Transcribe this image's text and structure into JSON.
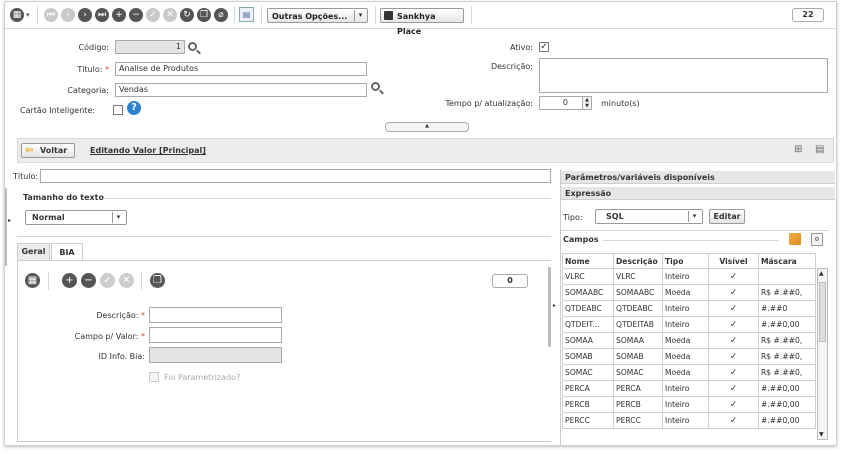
{
  "toolbar": {
    "outras_opcoes": "Outras Opções...",
    "sankhya_place": "Sankhya Place",
    "counter": "22"
  },
  "form": {
    "codigo_label": "Código:",
    "codigo_value": "1",
    "titulo_label": "Título:",
    "titulo_value": "Analise de Produtos",
    "categoria_label": "Categoria:",
    "categoria_value": "Vendas",
    "cartao_label": "Cartão Inteligente:",
    "ativo_label": "Ativo:",
    "descricao_label": "Descrição:",
    "tempo_label": "Tempo p/ atualização:",
    "tempo_value": "0",
    "minutos": "minuto(s)"
  },
  "nav": {
    "voltar": "Voltar",
    "editando": "Editando Valor [Principal]"
  },
  "left": {
    "titulo_label": "Título:",
    "tamanho_label": "Tamanho do texto",
    "tamanho_value": "Normal",
    "tabs": [
      "Geral",
      "BIA"
    ],
    "bia_counter": "0",
    "descricao_label": "Descrição:",
    "campo_label": "Campo p/ Valor:",
    "id_label": "ID Info. Bia:",
    "foi_param": "Foi Parametrizado?"
  },
  "right": {
    "param_header": "Parâmetros/variáveis disponíveis",
    "expr_header": "Expressão",
    "tipo_label": "Tipo:",
    "tipo_value": "SQL",
    "editar": "Editar",
    "campos_label": "Campos",
    "columns": [
      "Nome",
      "Descrição",
      "Tipo",
      "Visível",
      "Máscara"
    ],
    "rows": [
      [
        "VLRC",
        "VLRC",
        "Inteiro",
        "✓",
        ""
      ],
      [
        "SOMAABC",
        "SOMAABC",
        "Moeda",
        "✓",
        "R$ #.##0,"
      ],
      [
        "QTDEABC",
        "QTDEABC",
        "Inteiro",
        "✓",
        "#.##0"
      ],
      [
        "QTDEIT...",
        "QTDEITAB",
        "Inteiro",
        "✓",
        "#.##0,00"
      ],
      [
        "SOMAA",
        "SOMAA",
        "Moeda",
        "✓",
        "R$ #.##0,"
      ],
      [
        "SOMAB",
        "SOMAB",
        "Moeda",
        "✓",
        "R$ #.##0,"
      ],
      [
        "SOMAC",
        "SOMAC",
        "Moeda",
        "✓",
        "R$ #.##0,"
      ],
      [
        "PERCA",
        "PERCA",
        "Inteiro",
        "✓",
        "#.##0,00"
      ],
      [
        "PERCB",
        "PERCB",
        "Inteiro",
        "✓",
        "#.##0,00"
      ],
      [
        "PERCC",
        "PERCC",
        "Inteiro",
        "✓",
        "#.##0,00"
      ]
    ]
  }
}
